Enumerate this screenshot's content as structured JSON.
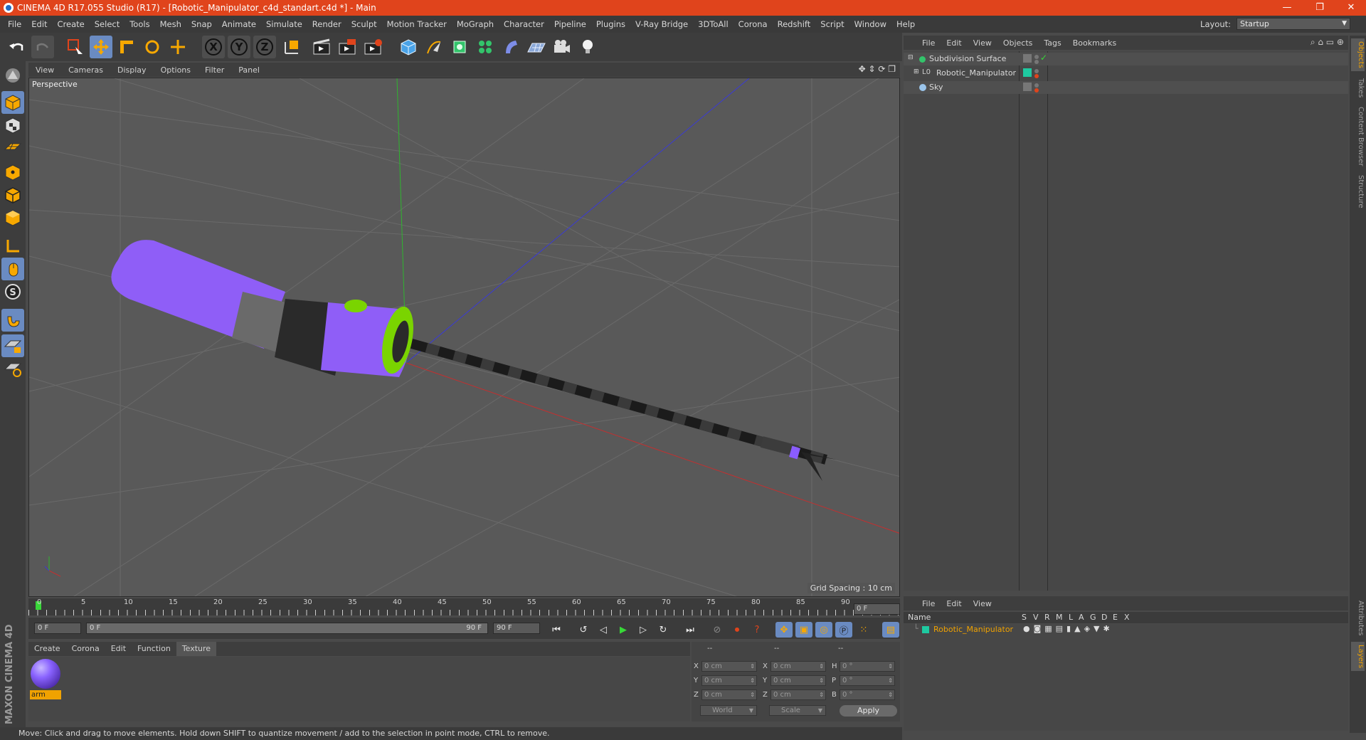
{
  "window": {
    "title": "CINEMA 4D R17.055 Studio (R17) - [Robotic_Manipulator_c4d_standart.c4d *] - Main",
    "minimize": "—",
    "restore": "❐",
    "close": "✕"
  },
  "menu": [
    "File",
    "Edit",
    "Create",
    "Select",
    "Tools",
    "Mesh",
    "Snap",
    "Animate",
    "Simulate",
    "Render",
    "Sculpt",
    "Motion Tracker",
    "MoGraph",
    "Character",
    "Pipeline",
    "Plugins",
    "V-Ray Bridge",
    "3DToAll",
    "Corona",
    "Redshift",
    "Script",
    "Window",
    "Help"
  ],
  "layout": {
    "label": "Layout:",
    "value": "Startup"
  },
  "toolbar_axes": [
    "X",
    "Y",
    "Z"
  ],
  "viewport": {
    "menu": [
      "View",
      "Cameras",
      "Display",
      "Options",
      "Filter",
      "Panel"
    ],
    "label": "Perspective",
    "grid_spacing": "Grid Spacing : 10 cm"
  },
  "timeline": {
    "ticks": [
      "0",
      "5",
      "10",
      "15",
      "20",
      "25",
      "30",
      "35",
      "40",
      "45",
      "50",
      "55",
      "60",
      "65",
      "70",
      "75",
      "80",
      "85",
      "90"
    ],
    "current_frame": "0 F",
    "start": "0 F",
    "range_start": "0 F",
    "range_end": "90 F",
    "end": "90 F"
  },
  "material": {
    "menu": [
      "Create",
      "Corona",
      "Edit",
      "Function",
      "Texture"
    ],
    "active_tab": "Texture",
    "items": [
      {
        "name": "arm"
      }
    ]
  },
  "coords": {
    "headers": [
      "--",
      "--",
      "--"
    ],
    "rows": [
      {
        "a": "X",
        "av": "0 cm",
        "b": "X",
        "bv": "0 cm",
        "c": "H",
        "cv": "0 °"
      },
      {
        "a": "Y",
        "av": "0 cm",
        "b": "Y",
        "bv": "0 cm",
        "c": "P",
        "cv": "0 °"
      },
      {
        "a": "Z",
        "av": "0 cm",
        "b": "Z",
        "bv": "0 cm",
        "c": "B",
        "cv": "0 °"
      }
    ],
    "space": "World",
    "mode": "Scale",
    "apply": "Apply"
  },
  "status": "Move: Click and drag to move elements. Hold down SHIFT to quantize movement / add to the selection in point mode, CTRL to remove.",
  "brand": "MAXON CINEMA 4D",
  "object_manager": {
    "menu": [
      "File",
      "Edit",
      "View",
      "Objects",
      "Tags",
      "Bookmarks"
    ],
    "objects": [
      {
        "name": "Subdivision Surface"
      },
      {
        "name": "Robotic_Manipulator"
      },
      {
        "name": "Sky"
      }
    ]
  },
  "right_tabs_top": [
    "Objects",
    "Takes",
    "Content Browser",
    "Structure"
  ],
  "right_tabs_bottom": [
    "Attributes",
    "Layers"
  ],
  "layer_manager": {
    "menu": [
      "File",
      "Edit",
      "View"
    ],
    "columns": [
      "Name",
      "S",
      "V",
      "R",
      "M",
      "L",
      "A",
      "G",
      "D",
      "E",
      "X"
    ],
    "layers": [
      {
        "name": "Robotic_Manipulator",
        "color": "#1ec9a0"
      }
    ]
  },
  "colors": {
    "titlebar": "#e0441c",
    "accent": "#f0a200",
    "highlight": "#6a8bc2",
    "purple": "#8a5cff",
    "green": "#7ad400"
  }
}
